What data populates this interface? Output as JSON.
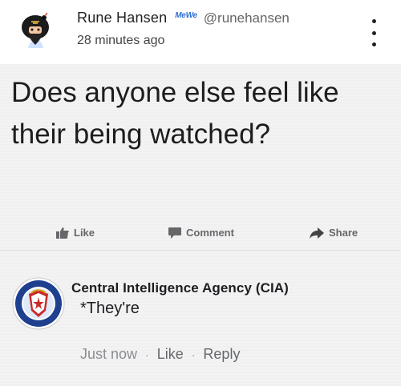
{
  "post": {
    "author_name": "Rune Hansen",
    "badge": "MeWe",
    "handle": "@runehansen",
    "timestamp": "28 minutes ago"
  },
  "shared_image": {
    "question": "Does anyone else feel like their being watched?",
    "actions": {
      "like": "Like",
      "comment": "Comment",
      "share": "Share"
    },
    "comment": {
      "author": "Central Intelligence Agency (CIA)",
      "text": "*They're",
      "time": "Just now",
      "like": "Like",
      "reply": "Reply"
    }
  },
  "colors": {
    "background": "#ffffff",
    "image_background": "#f3f3f3",
    "badge_blue": "#2f6fd6",
    "action_gray": "#65676b",
    "cia_blue": "#1f3f8f"
  },
  "icons": [
    "avatar-illustration",
    "more-vertical-icon",
    "like-icon",
    "comment-icon",
    "share-icon",
    "cia-seal"
  ]
}
